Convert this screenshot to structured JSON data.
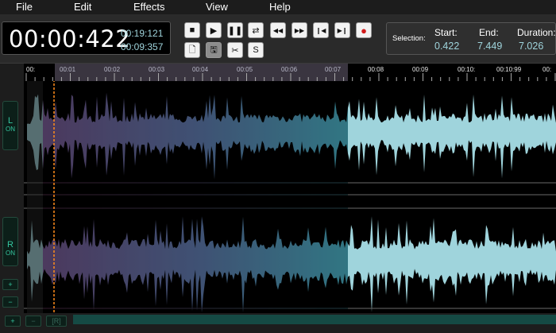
{
  "menu": {
    "items": [
      "File",
      "Edit",
      "Effects",
      "View",
      "Help"
    ]
  },
  "time": {
    "main": "00:00:422",
    "total": "00:19:121",
    "visible": "00:09:357"
  },
  "transport": {
    "buttons": [
      {
        "name": "stop",
        "glyph": "■"
      },
      {
        "name": "play",
        "glyph": "▶"
      },
      {
        "name": "pause",
        "glyph": "❚❚"
      },
      {
        "name": "loop",
        "glyph": "⇄"
      },
      {
        "name": "rewind",
        "glyph": "◀◀"
      },
      {
        "name": "fast-forward",
        "glyph": "▶▶"
      },
      {
        "name": "skip-start",
        "glyph": "❙◀"
      },
      {
        "name": "skip-end",
        "glyph": "▶❙"
      },
      {
        "name": "record",
        "glyph": "●"
      }
    ],
    "edit_buttons": [
      {
        "name": "new-file",
        "glyph": "🗋"
      },
      {
        "name": "save",
        "glyph": "🖫"
      },
      {
        "name": "cut",
        "glyph": "✂"
      },
      {
        "name": "silence",
        "glyph": "S"
      }
    ]
  },
  "selection": {
    "label": "Selection:",
    "start_label": "Start:",
    "start": "0.422",
    "end_label": "End:",
    "end": "7.449",
    "duration_label": "Duration:",
    "duration": "7.026"
  },
  "ruler": {
    "labels": [
      "00:",
      "00:01",
      "00:02",
      "00:03",
      "00:04",
      "00:05",
      "00:06",
      "00:07",
      "00:08",
      "00:09",
      "00:10:",
      "00:10:99",
      "00:"
    ]
  },
  "channels": {
    "left": {
      "letter": "L",
      "state": "ON"
    },
    "right": {
      "letter": "R",
      "state": "ON"
    }
  },
  "zoom": {
    "in_glyph": "+",
    "out_glyph": "−",
    "reset_label": "[R]"
  },
  "colors": {
    "accent": "#35c6a0",
    "waveform": "#9fd4dc",
    "cursor": "#ff8c1a",
    "value_text": "#9fd4dc"
  }
}
